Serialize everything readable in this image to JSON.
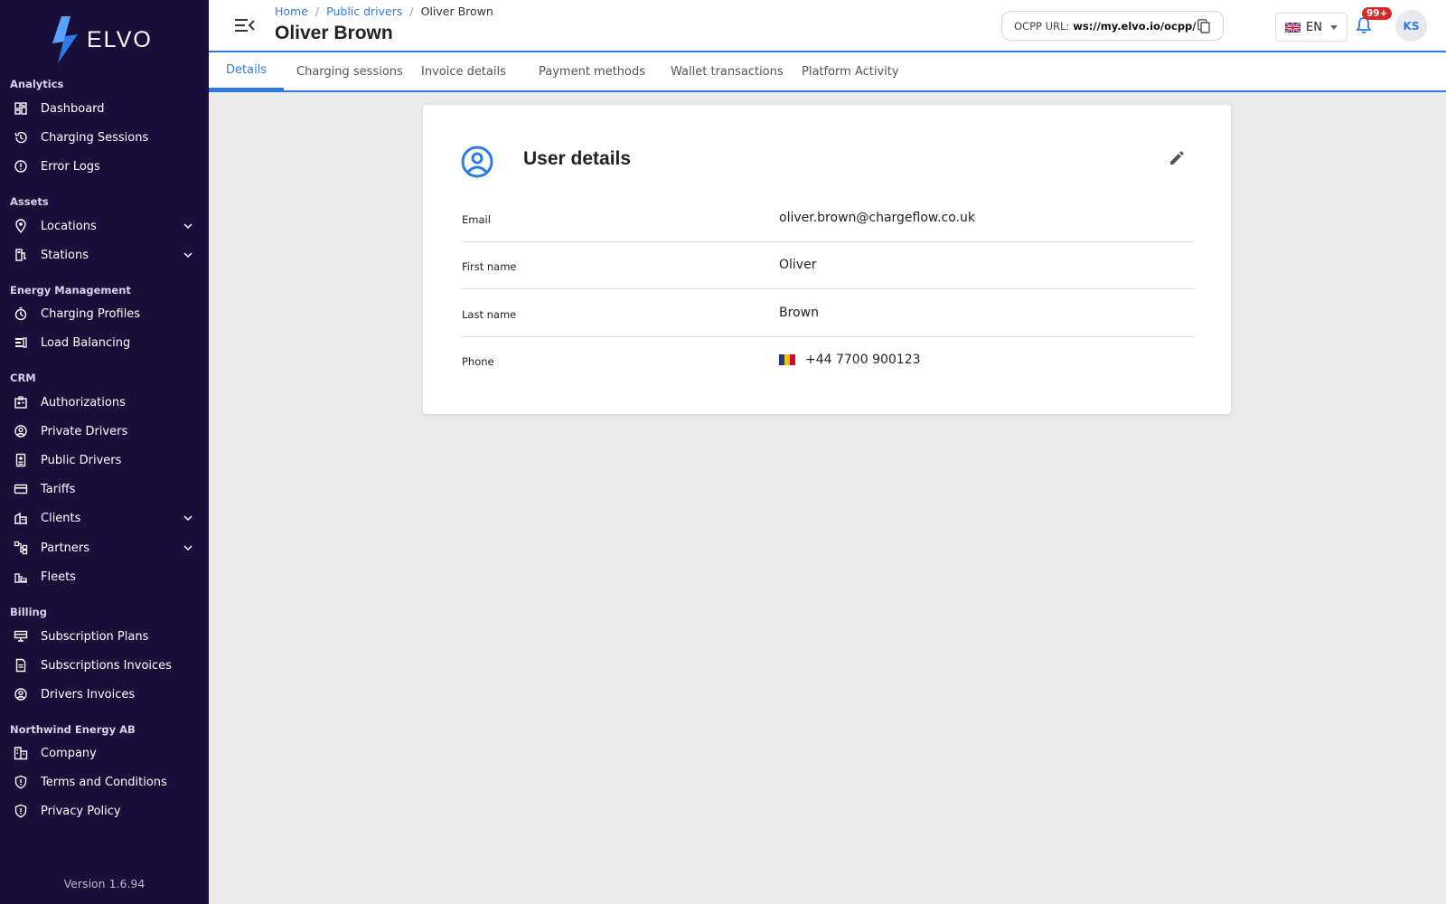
{
  "brand": {
    "name": "ELVO",
    "version": "Version 1.6.94",
    "accent": "#2e7be6",
    "sidebar_bg": "#1a0e3a"
  },
  "sidebar": {
    "sections": [
      {
        "title": "Analytics",
        "items": [
          {
            "label": "Dashboard",
            "icon": "dashboard-icon"
          },
          {
            "label": "Charging Sessions",
            "icon": "history-icon"
          },
          {
            "label": "Error Logs",
            "icon": "alert-circle-icon"
          }
        ]
      },
      {
        "title": "Assets",
        "items": [
          {
            "label": "Locations",
            "icon": "location-pin-icon",
            "expandable": true
          },
          {
            "label": "Stations",
            "icon": "station-icon",
            "expandable": true
          }
        ]
      },
      {
        "title": "Energy Management",
        "items": [
          {
            "label": "Charging Profiles",
            "icon": "timer-icon"
          },
          {
            "label": "Load Balancing",
            "icon": "load-balancing-icon"
          }
        ]
      },
      {
        "title": "CRM",
        "items": [
          {
            "label": "Authorizations",
            "icon": "badge-icon"
          },
          {
            "label": "Private Drivers",
            "icon": "user-circle-icon"
          },
          {
            "label": "Public Drivers",
            "icon": "driver-card-icon"
          },
          {
            "label": "Tariffs",
            "icon": "credit-card-icon"
          },
          {
            "label": "Clients",
            "icon": "buildings-icon",
            "expandable": true
          },
          {
            "label": "Partners",
            "icon": "network-icon",
            "expandable": true
          },
          {
            "label": "Fleets",
            "icon": "fleet-icon"
          }
        ]
      },
      {
        "title": "Billing",
        "items": [
          {
            "label": "Subscription Plans",
            "icon": "plan-icon"
          },
          {
            "label": "Subscriptions Invoices",
            "icon": "document-icon"
          },
          {
            "label": "Drivers Invoices",
            "icon": "user-circle-icon"
          }
        ]
      },
      {
        "title": "Northwind Energy AB",
        "items": [
          {
            "label": "Company",
            "icon": "company-icon"
          },
          {
            "label": "Terms and Conditions",
            "icon": "shield-icon"
          },
          {
            "label": "Privacy Policy",
            "icon": "shield-icon"
          }
        ]
      }
    ]
  },
  "header": {
    "breadcrumb": {
      "home": "Home",
      "parent": "Public drivers",
      "current": "Oliver Brown",
      "separator": "/"
    },
    "title": "Oliver Brown",
    "ocpp_label": "OCPP URL:",
    "ocpp_url": "ws://my.elvo.io/ocpp/",
    "language": "EN",
    "notifications_badge": "99+",
    "avatar_initials": "KS"
  },
  "tabs": [
    "Details",
    "Charging sessions",
    "Invoice details",
    "Payment methods",
    "Wallet transactions",
    "Platform Activity"
  ],
  "active_tab": "Details",
  "user_details": {
    "title": "User details",
    "fields": [
      {
        "label": "Email",
        "value": "oliver.brown@chargeflow.co.uk"
      },
      {
        "label": "First name",
        "value": "Oliver"
      },
      {
        "label": "Last name",
        "value": "Brown"
      },
      {
        "label": "Phone",
        "value": "+44 7700 900123"
      }
    ]
  }
}
